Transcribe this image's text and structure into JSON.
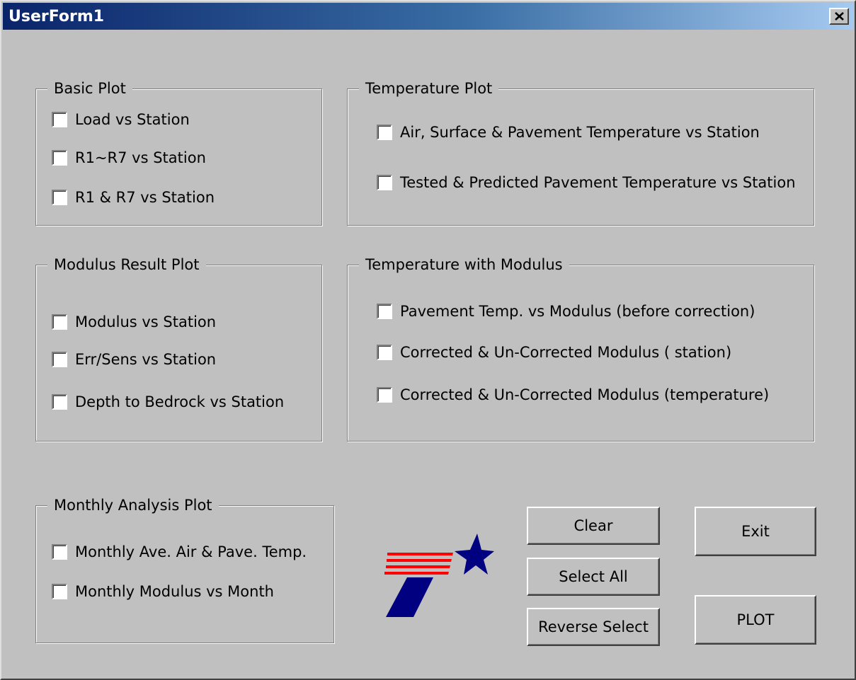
{
  "window": {
    "title": "UserForm1",
    "close_icon": "close-icon"
  },
  "basic_plot": {
    "legend": "Basic Plot",
    "items": [
      "Load vs Station",
      "R1~R7 vs Station",
      "R1 & R7 vs Station"
    ],
    "checked": [
      false,
      false,
      false
    ]
  },
  "temperature_plot": {
    "legend": "Temperature Plot",
    "items": [
      "Air, Surface & Pavement Temperature  vs  Station",
      "Tested & Predicted Pavement Temperature vs Station"
    ],
    "checked": [
      false,
      false
    ]
  },
  "modulus_result_plot": {
    "legend": "Modulus Result Plot",
    "items": [
      "Modulus vs  Station",
      "Err/Sens  vs  Station",
      "Depth to Bedrock  vs  Station"
    ],
    "checked": [
      false,
      false,
      false
    ]
  },
  "temperature_with_modulus": {
    "legend": "Temperature with Modulus",
    "items": [
      "Pavement Temp. vs  Modulus (before correction)",
      "Corrected & Un-Corrected Modulus ( station)",
      "Corrected & Un-Corrected Modulus (temperature)"
    ],
    "checked": [
      false,
      false,
      false
    ]
  },
  "monthly_analysis_plot": {
    "legend": "Monthly Analysis Plot",
    "items": [
      "Monthly Ave. Air  & Pave. Temp.",
      "Monthly Modulus vs Month"
    ],
    "checked": [
      false,
      false
    ]
  },
  "buttons": {
    "clear": "Clear",
    "select_all": "Select All",
    "reverse_select": "Reverse Select",
    "exit": "Exit",
    "plot": "PLOT"
  },
  "logo": {
    "icon": "txdot-logo-icon",
    "colors": {
      "red": "#ff0000",
      "blue": "#000080"
    }
  }
}
